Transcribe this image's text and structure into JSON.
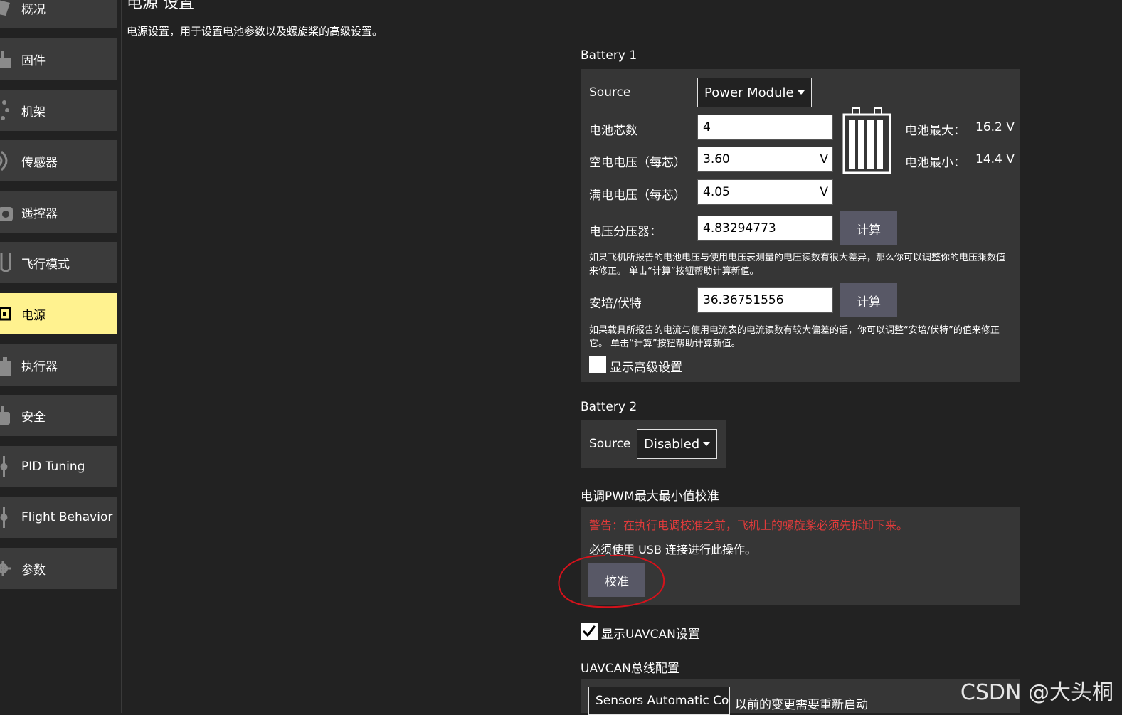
{
  "sidebar": {
    "items": [
      {
        "label": "概况",
        "icon": "summary-icon"
      },
      {
        "label": "固件",
        "icon": "firmware-icon"
      },
      {
        "label": "机架",
        "icon": "airframe-icon"
      },
      {
        "label": "传感器",
        "icon": "sensors-icon"
      },
      {
        "label": "遥控器",
        "icon": "radio-icon"
      },
      {
        "label": "飞行模式",
        "icon": "flight-modes-icon"
      },
      {
        "label": "电源",
        "icon": "power-icon",
        "active": true
      },
      {
        "label": "执行器",
        "icon": "actuators-icon"
      },
      {
        "label": "安全",
        "icon": "safety-icon"
      },
      {
        "label": "PID Tuning",
        "icon": "tuning-icon"
      },
      {
        "label": "Flight Behavior",
        "icon": "flight-behavior-icon"
      },
      {
        "label": "参数",
        "icon": "gear-icon"
      }
    ],
    "active_color": "#fff28f"
  },
  "header": {
    "title": "电源 设置",
    "description": "电源设置，用于设置电池参数以及螺旋桨的高级设置。"
  },
  "battery1": {
    "title": "Battery 1",
    "source_label": "Source",
    "source_value": "Power Module",
    "cells_label": "电池芯数",
    "cells_value": "4",
    "empty_label": "空电电压（每芯）",
    "empty_value": "3.60",
    "empty_unit": "V",
    "full_label": "满电电压（每芯）",
    "full_value": "4.05",
    "full_unit": "V",
    "divider_label": "电压分压器：",
    "divider_value": "4.83294773",
    "calc_label": "计算",
    "divider_note": "如果飞机所报告的电池电压与使用电压表测量的电压读数有很大差异，那么你可以调整你的电压乘数值来修正。 单击“计算”按钮帮助计算新值。",
    "amps_label": "安培/伏特",
    "amps_value": "36.36751556",
    "amps_note": "如果载具所报告的电流与使用电流表的电流读数有较大偏差的话，你可以调整“安培/伏特”的值来修正它。 单击“计算”按钮帮助计算新值。",
    "advanced_label": "显示高级设置",
    "advanced_checked": false,
    "max_label": "电池最大：",
    "max_value": "16.2 V",
    "min_label": "电池最小：",
    "min_value": "14.4 V"
  },
  "battery2": {
    "title": "Battery 2",
    "source_label": "Source",
    "source_value": "Disabled"
  },
  "esc": {
    "title": "电调PWM最大最小值校准",
    "warning": "警告：在执行电调校准之前，飞机上的螺旋桨必须先拆卸下来。",
    "usb_note": "必须使用 USB 连接进行此操作。",
    "calibrate_label": "校准",
    "warning_color": "#e23b3b",
    "annotation_color": "#d6121b"
  },
  "uavcan": {
    "show_label": "显示UAVCAN设置",
    "show_checked": true,
    "bus_title": "UAVCAN总线配置",
    "bus_value": "Sensors Automatic Config",
    "restart_note": "以前的变更需要重新启动"
  },
  "watermark": "CSDN @大头桐"
}
